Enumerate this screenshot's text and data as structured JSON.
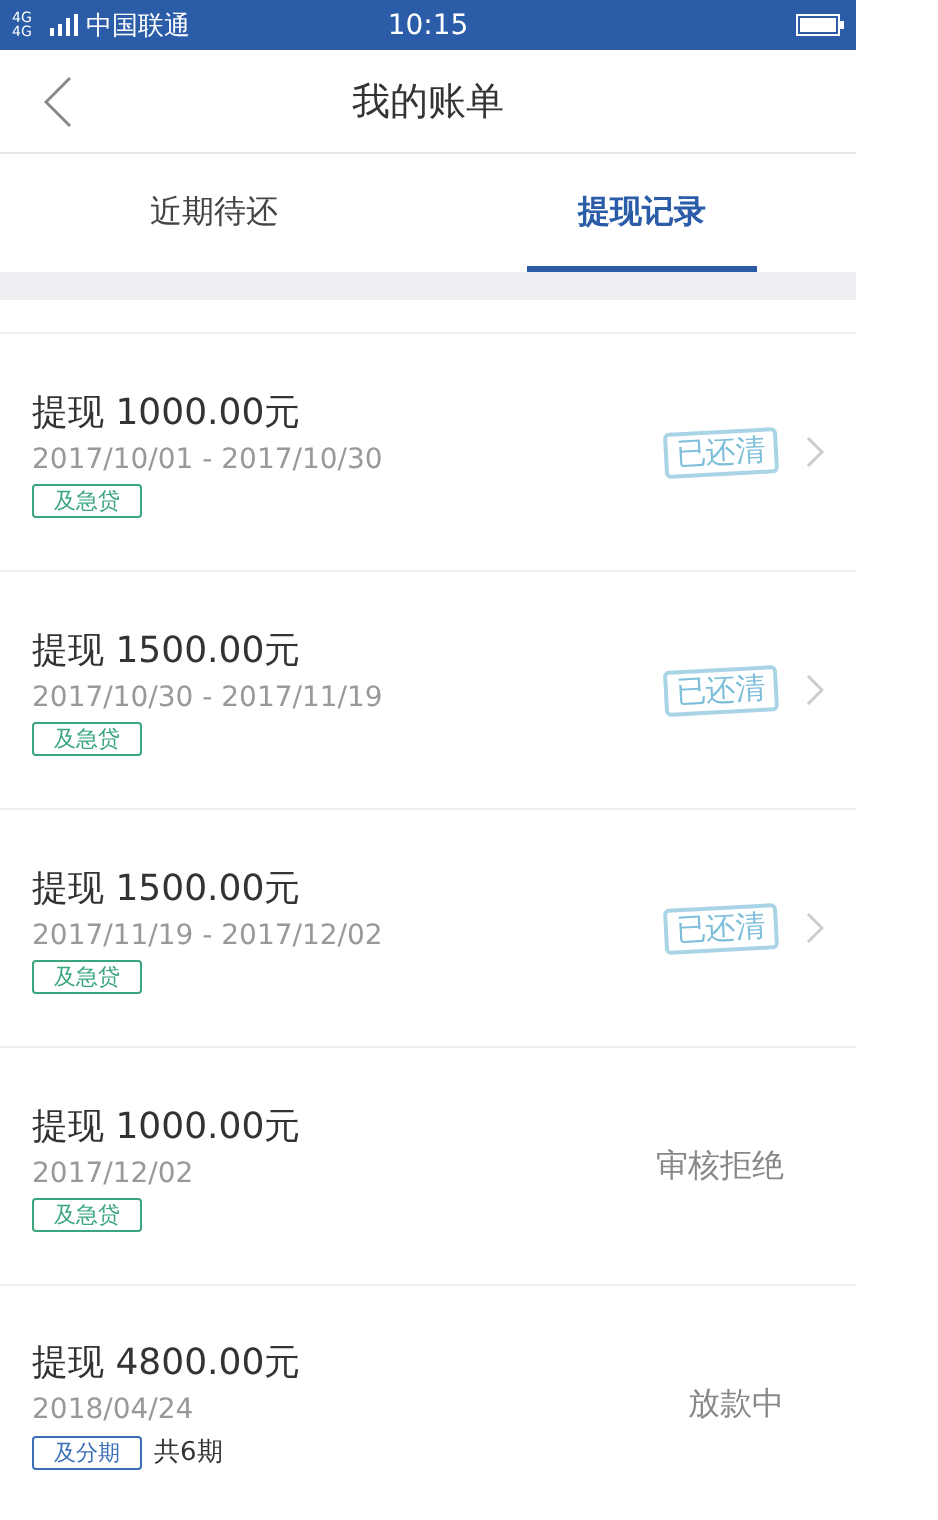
{
  "status_bar": {
    "network": "4G 4G",
    "carrier": "中国联通",
    "time": "10:15"
  },
  "nav": {
    "title": "我的账单"
  },
  "tabs": [
    {
      "label": "近期待还",
      "selected": false
    },
    {
      "label": "提现记录",
      "selected": true
    }
  ],
  "records": [
    {
      "title": "提现 1000.00元",
      "date": "2017/10/01 - 2017/10/30",
      "tag": {
        "label": "及急贷",
        "kind": "green"
      },
      "status": {
        "label": "已还清",
        "kind": "stamp"
      }
    },
    {
      "title": "提现 1500.00元",
      "date": "2017/10/30 - 2017/11/19",
      "tag": {
        "label": "及急贷",
        "kind": "green"
      },
      "status": {
        "label": "已还清",
        "kind": "stamp"
      }
    },
    {
      "title": "提现 1500.00元",
      "date": "2017/11/19 - 2017/12/02",
      "tag": {
        "label": "及急贷",
        "kind": "green"
      },
      "status": {
        "label": "已还清",
        "kind": "stamp"
      }
    },
    {
      "title": "提现 1000.00元",
      "date": "2017/12/02",
      "tag": {
        "label": "及急贷",
        "kind": "green"
      },
      "status": {
        "label": "审核拒绝",
        "kind": "text"
      }
    },
    {
      "title": "提现 4800.00元",
      "date": "2018/04/24",
      "tag": {
        "label": "及分期",
        "kind": "blue"
      },
      "note": "共6期",
      "status": {
        "label": "放款中",
        "kind": "text"
      }
    }
  ]
}
